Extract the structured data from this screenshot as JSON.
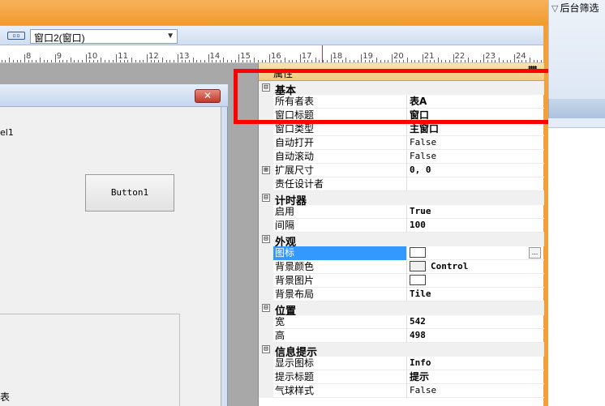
{
  "toolbar": {
    "layout_icon": "layout-icon",
    "window_selector": "窗口2(窗口)"
  },
  "ruler": {
    "numbers": [
      "8",
      "9",
      "10",
      "11",
      "12",
      "13",
      "14",
      "15",
      "16",
      "17",
      "18",
      "19",
      "20",
      "21",
      "22",
      "23",
      "24"
    ]
  },
  "designer": {
    "close_label": "✕",
    "label1_text": "el1",
    "button1_text": "Button1",
    "subpanel_text": "表"
  },
  "property_grid": {
    "header_title": "属性",
    "pin_icon": "pin-icon",
    "categories": [
      {
        "name": "基本",
        "expander": "⊟",
        "rows": [
          {
            "name": "所有者表",
            "value": "表A"
          },
          {
            "name": "窗口标题",
            "value": "窗口"
          },
          {
            "name": "窗口类型",
            "value": "主窗口"
          },
          {
            "name": "自动打开",
            "value": "False"
          },
          {
            "name": "自动滚动",
            "value": "False"
          },
          {
            "name": "扩展尺寸",
            "value": "0, 0",
            "expander": "⊞"
          },
          {
            "name": "责任设计者",
            "value": ""
          }
        ]
      },
      {
        "name": "计时器",
        "expander": "⊟",
        "rows": [
          {
            "name": "启用",
            "value": "True"
          },
          {
            "name": "间隔",
            "value": "100"
          }
        ]
      },
      {
        "name": "外观",
        "expander": "⊟",
        "rows": [
          {
            "name": "图标",
            "value": "",
            "ellipsis": "..."
          },
          {
            "name": "背景颜色",
            "value": "Control"
          },
          {
            "name": "背景图片",
            "value": ""
          },
          {
            "name": "背景布局",
            "value": "Tile"
          }
        ]
      },
      {
        "name": "位置",
        "expander": "⊟",
        "rows": [
          {
            "name": "宽",
            "value": "542"
          },
          {
            "name": "高",
            "value": "498"
          }
        ]
      },
      {
        "name": "信息提示",
        "expander": "⊟",
        "rows": [
          {
            "name": "显示图标",
            "value": "Info"
          },
          {
            "name": "提示标题",
            "value": "提示"
          },
          {
            "name": "气球样式",
            "value": "False"
          }
        ]
      }
    ]
  },
  "right_dock": {
    "filter_label": "后台筛选",
    "filter_icon": "filter-icon"
  },
  "colors": {
    "frame_orange": "#f3a03a",
    "highlight_red": "#ff0000",
    "selection_blue": "#3399ff"
  }
}
